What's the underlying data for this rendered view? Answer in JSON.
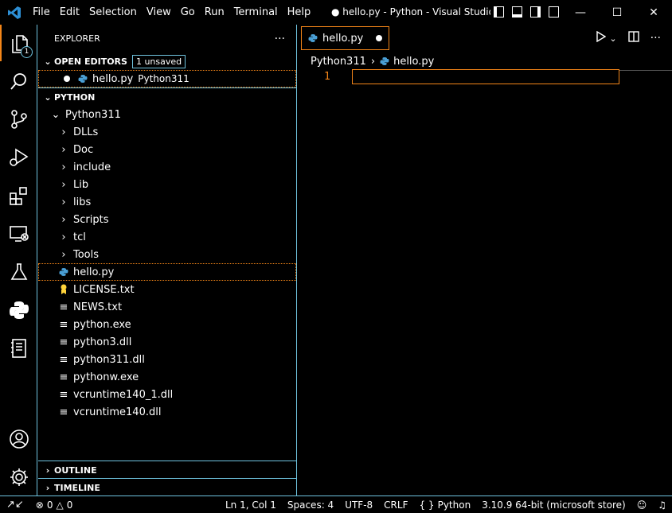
{
  "titlebar": {
    "menu": [
      "File",
      "Edit",
      "Selection",
      "View",
      "Go",
      "Run",
      "Terminal",
      "Help"
    ],
    "title": "● hello.py - Python - Visual Studio C..."
  },
  "activity": {
    "explorer_badge": "1"
  },
  "sidebar": {
    "header": "EXPLORER",
    "more": "···",
    "open_editors": {
      "label": "OPEN EDITORS",
      "badge": "1 unsaved",
      "items": [
        {
          "name": "hello.py",
          "desc": "Python311"
        }
      ]
    },
    "folder": {
      "label": "PYTHON",
      "root": "Python311",
      "folders": [
        "DLLs",
        "Doc",
        "include",
        "Lib",
        "libs",
        "Scripts",
        "tcl",
        "Tools"
      ],
      "files": [
        "hello.py",
        "LICENSE.txt",
        "NEWS.txt",
        "python.exe",
        "python3.dll",
        "python311.dll",
        "pythonw.exe",
        "vcruntime140_1.dll",
        "vcruntime140.dll"
      ]
    },
    "outline": "OUTLINE",
    "timeline": "TIMELINE"
  },
  "editor": {
    "tab": "hello.py",
    "breadcrumb": [
      "Python311",
      "hello.py"
    ],
    "line_number": "1"
  },
  "statusbar": {
    "errors": "0",
    "warnings": "0",
    "position": "Ln 1, Col 1",
    "spaces": "Spaces: 4",
    "encoding": "UTF-8",
    "eol": "CRLF",
    "language": "Python",
    "interpreter": "3.10.9 64-bit (microsoft store)"
  },
  "colors": {
    "accent": "#6fc3df",
    "focus": "#f38518",
    "python_blue": "#4a9fd5",
    "python_yellow": "#ffd43b",
    "vscode_blue": "#2d8fd5"
  }
}
